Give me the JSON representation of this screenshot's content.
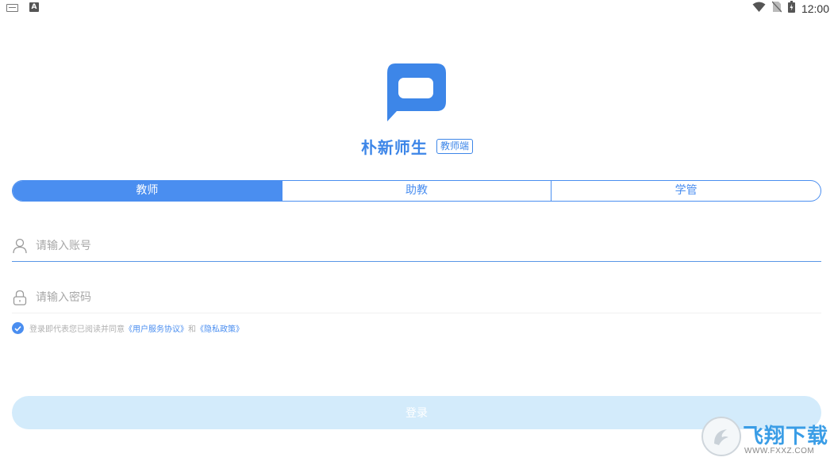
{
  "status_bar": {
    "left_icons": [
      "keyboard-icon",
      "a-notification-icon"
    ],
    "a_icon_text": "A",
    "right_icons": [
      "wifi-icon",
      "no-sim-icon",
      "battery-charging-icon"
    ],
    "time": "12:00"
  },
  "app": {
    "logo_icon": "chat-bubble-logo-icon",
    "name": "朴新师生",
    "badge": "教师端",
    "brand_color": "#3d86e8"
  },
  "role_tabs": {
    "items": [
      {
        "label": "教师",
        "selected": true
      },
      {
        "label": "助教",
        "selected": false
      },
      {
        "label": "学管",
        "selected": false
      }
    ],
    "accent": "#4a8ef0"
  },
  "form": {
    "account": {
      "placeholder": "请输入账号",
      "value": "",
      "icon": "user-icon"
    },
    "password": {
      "placeholder": "请输入密码",
      "value": "",
      "icon": "lock-icon"
    }
  },
  "agreement": {
    "checked": true,
    "prefix": "登录即代表您已阅读并同意",
    "terms_link": "《用户服务协议》",
    "conjunction": "和",
    "privacy_link": "《隐私政策》"
  },
  "login_button": {
    "label": "登录",
    "background": "#d3ebfb"
  },
  "watermark": {
    "title": "飞翔下载",
    "url": "WWW.FXXZ.COM"
  }
}
